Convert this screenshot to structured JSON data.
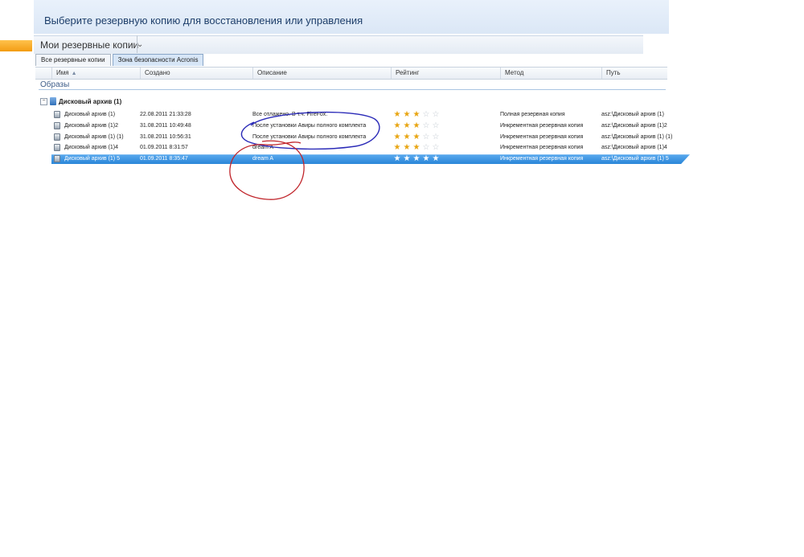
{
  "window": {
    "title": "Выберите резервную копию для восстановления или управления"
  },
  "section": {
    "title": "Мои резервные копии",
    "glyph": "⌄"
  },
  "tabs": [
    {
      "label": "Все резервные копии",
      "active": false
    },
    {
      "label": "Зона безопасности Acronis",
      "active": true
    }
  ],
  "columns": {
    "name": "Имя",
    "created": "Создано",
    "description": "Описание",
    "rating": "Рейтинг",
    "method": "Метод",
    "path": "Путь",
    "sort_indicator": "▲"
  },
  "images_label": "Образы",
  "group": {
    "expander": "−",
    "label": "Дисковый архив (1)"
  },
  "rows": [
    {
      "name": "Дисковый архив (1)",
      "created": "22.08.2011 21:33:28",
      "description": "Все отлажено. В т.ч. FireFox.",
      "rating": 3,
      "method": "Полная резервная копия",
      "path": "asz:\\Дисковый архив (1)",
      "selected": false
    },
    {
      "name": "Дисковый архив (1)2",
      "created": "31.08.2011 10:49:48",
      "description": "После установки Авиры полного комплекта",
      "rating": 3,
      "method": "Инкрементная резервная копия",
      "path": "asz:\\Дисковый архив (1)2",
      "selected": false
    },
    {
      "name": "Дисковый архив (1) (1)",
      "created": "31.08.2011 10:56:31",
      "description": "После установки Авиры полного комплекта",
      "rating": 3,
      "method": "Инкрементная резервная копия",
      "path": "asz:\\Дисковый архив (1) (1)",
      "selected": false
    },
    {
      "name": "Дисковый архив (1)4",
      "created": "01.09.2011 8:31:57",
      "description": "dream A",
      "rating": 3,
      "method": "Инкрементная резервная копия",
      "path": "asz:\\Дисковый архив (1)4",
      "selected": false
    },
    {
      "name": "Дисковый архив (1) 5",
      "created": "01.09.2011 8:35:47",
      "description": "dream A",
      "rating": 5,
      "method": "Инкрементная резервная копия",
      "path": "asz:\\Дисковый архив (1) 5",
      "selected": true
    }
  ],
  "rating_max": 5,
  "colors": {
    "selection": "#2a86d8",
    "star_on": "#e8a512",
    "annotation_blue": "#2b2bb8",
    "annotation_red": "#c0242a"
  }
}
